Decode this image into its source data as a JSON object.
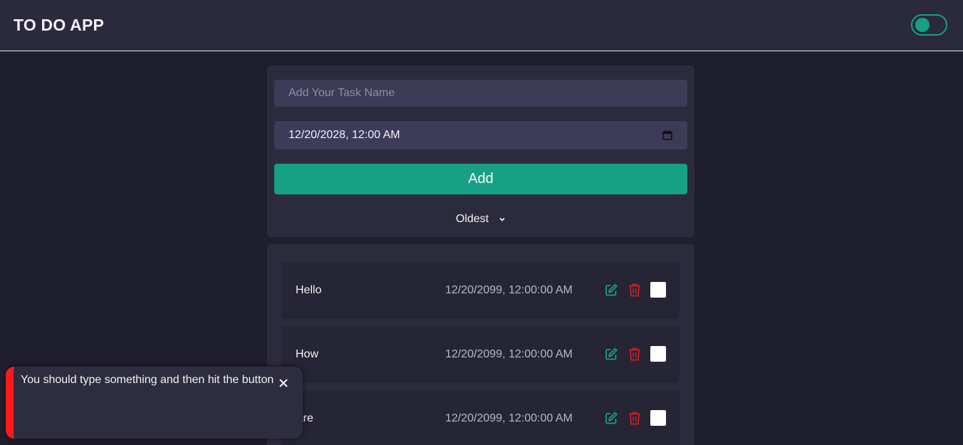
{
  "header": {
    "title": "TO DO APP",
    "theme_toggle_on": true
  },
  "form": {
    "task_placeholder": "Add Your Task Name",
    "task_value": "",
    "date_value": "12/20/2028, 12:00 AM",
    "add_label": "Add",
    "sort_selected": "Oldest"
  },
  "tasks": [
    {
      "name": "Hello",
      "date": "12/20/2099, 12:00:00 AM",
      "completed": false
    },
    {
      "name": "How",
      "date": "12/20/2099, 12:00:00 AM",
      "completed": false
    },
    {
      "name": "Are",
      "date": "12/20/2099, 12:00:00 AM",
      "completed": false
    }
  ],
  "toast": {
    "message": "You should type something and then hit the button",
    "type": "error"
  },
  "colors": {
    "accent": "#16a085",
    "danger": "#cc1f1f",
    "toast_bar": "#ff1a1a",
    "background": "#1f1e2c",
    "card": "#2c2b3d"
  },
  "icons": {
    "edit": "edit-icon",
    "delete": "trash-icon",
    "close": "close-icon",
    "calendar": "calendar-icon",
    "dropdown": "chevron-down-icon"
  }
}
